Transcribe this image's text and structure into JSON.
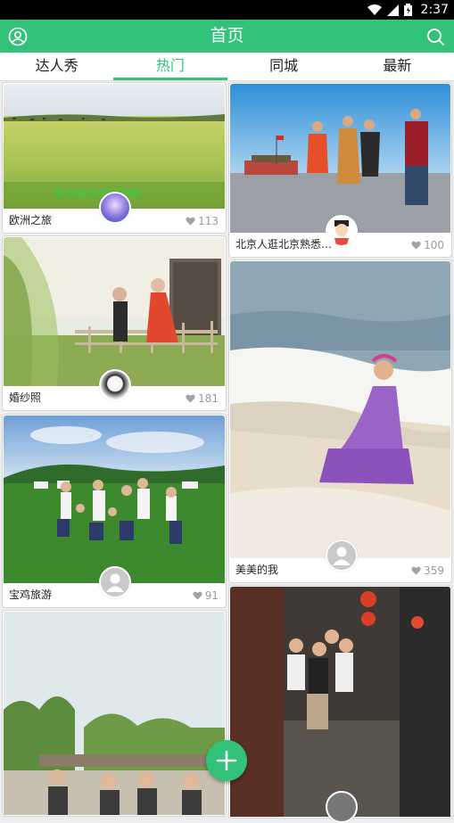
{
  "status_bar": {
    "time": "2:37"
  },
  "header": {
    "title": "首页",
    "left_icon": "profile-icon",
    "right_icon": "search-icon"
  },
  "tabs": [
    {
      "label": "达人秀",
      "active": false
    },
    {
      "label": "热门",
      "active": true
    },
    {
      "label": "同城",
      "active": false
    },
    {
      "label": "最新",
      "active": false
    }
  ],
  "feed": {
    "left": [
      {
        "title": "欧洲之旅",
        "likes": "113",
        "overlay_text": "欧洲旅游游记加精"
      },
      {
        "title": "婚纱照",
        "likes": "181"
      },
      {
        "title": "宝鸡旅游",
        "likes": "91"
      },
      {
        "title": ""
      }
    ],
    "right": [
      {
        "title": "北京人逛北京熟悉…",
        "likes": "100"
      },
      {
        "title": "美美的我",
        "likes": "359"
      },
      {
        "title": ""
      }
    ]
  },
  "fab": {
    "icon": "plus-icon"
  },
  "colors": {
    "accent": "#32c27a"
  }
}
